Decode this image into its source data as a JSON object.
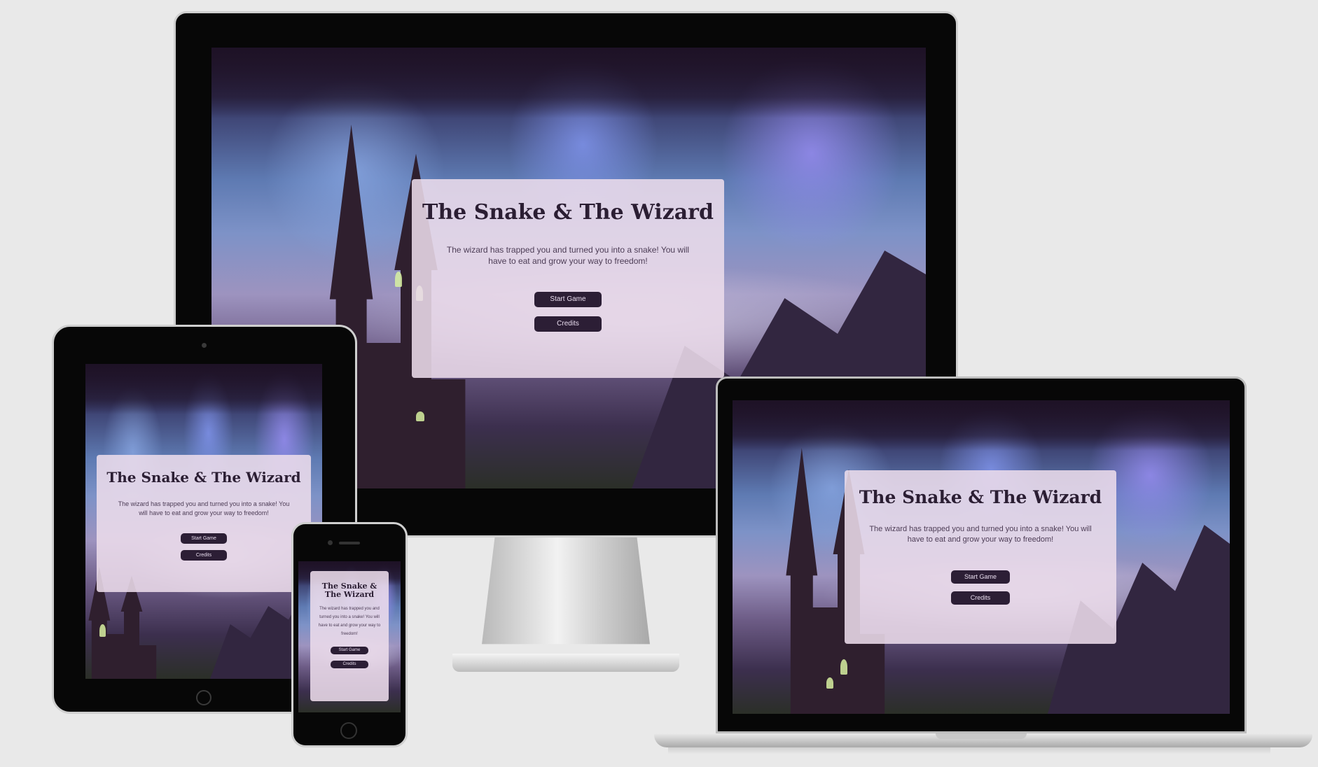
{
  "site": {
    "title": "The Snake & The Wizard",
    "description": "The wizard has trapped you and turned you into a snake! You will have to eat and grow your way to freedom!",
    "start_button": "Start Game",
    "credits_button": "Credits"
  },
  "colors": {
    "background": "#e9e9e9",
    "panel": "#ecdcea",
    "button": "#2c1e35",
    "button_text": "#e8dcee",
    "title_text": "#2b1e33"
  },
  "devices": [
    "desktop-monitor",
    "laptop",
    "tablet",
    "phone"
  ]
}
